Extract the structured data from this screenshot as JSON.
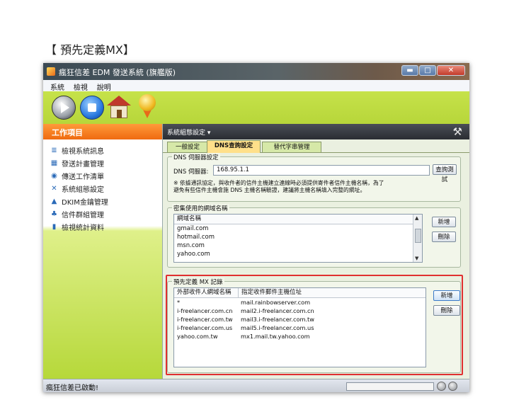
{
  "page_heading": "【 預先定義MX】",
  "window": {
    "title": "瘋狂信差 EDM 發送系統 (旗艦版)",
    "controls": {
      "minimize": "▬",
      "maximize": "□",
      "close": "✕"
    }
  },
  "menu": [
    "系統",
    "檢視",
    "說明"
  ],
  "toolbar": [
    "play-icon",
    "stop-icon",
    "home-icon",
    "medal-icon"
  ],
  "sidebar": {
    "header": "工作項目",
    "items": [
      {
        "label": "檢視系統訊息",
        "icon": "≣"
      },
      {
        "label": "發送計畫管理",
        "icon": "▦"
      },
      {
        "label": "傳送工作清單",
        "icon": "◉"
      },
      {
        "label": "系統組態設定",
        "icon": "✕"
      },
      {
        "label": "DKIM金鑰管理",
        "icon": "▲"
      },
      {
        "label": "信件群組管理",
        "icon": "♣"
      },
      {
        "label": "檢視統計資料",
        "icon": "▮"
      }
    ]
  },
  "main": {
    "header": "系統組態設定 ▾",
    "tabs": [
      "一般設定",
      "DNS查詢設定",
      "替代字串管理"
    ],
    "active_tab": "DNS查詢設定"
  },
  "dns_server": {
    "title": "DNS 伺服器設定",
    "label": "DNS 伺服器:",
    "value": "168.95.1.1",
    "test_button": "查詢測試",
    "note_line1": "※ 依據通訊協定，與收件者的信件主機建立連線時必須提供寄件者信件主機名稱，為了",
    "note_line2": "避免有些信件主機會施 DNS 主機名稱驗證，建議將主機名稱填入完整的網址。"
  },
  "domains": {
    "title": "密集使用的網域名稱",
    "column": "網域名稱",
    "rows": [
      "gmail.com",
      "hotmail.com",
      "msn.com",
      "yahoo.com"
    ],
    "add": "新增",
    "delete": "刪除"
  },
  "mx": {
    "title": "預先定義 MX 記錄",
    "col1": "外部收件人網域名稱",
    "col2": "指定收件郵件主機位址",
    "rows": [
      {
        "domain": "*",
        "host": "mail.rainbowserver.com"
      },
      {
        "domain": "i-freelancer.com.cn",
        "host": "mail2.i-freelancer.com.cn"
      },
      {
        "domain": "i-freelancer.com.tw",
        "host": "mail3.i-freelancer.com.tw"
      },
      {
        "domain": "i-freelancer.com.us",
        "host": "mail5.i-freelancer.com.us"
      },
      {
        "domain": "yahoo.com.tw",
        "host": "mx1.mail.tw.yahoo.com"
      }
    ],
    "add": "新增",
    "delete": "刪除"
  },
  "status": {
    "text": "瘋狂信差已啟動!"
  }
}
